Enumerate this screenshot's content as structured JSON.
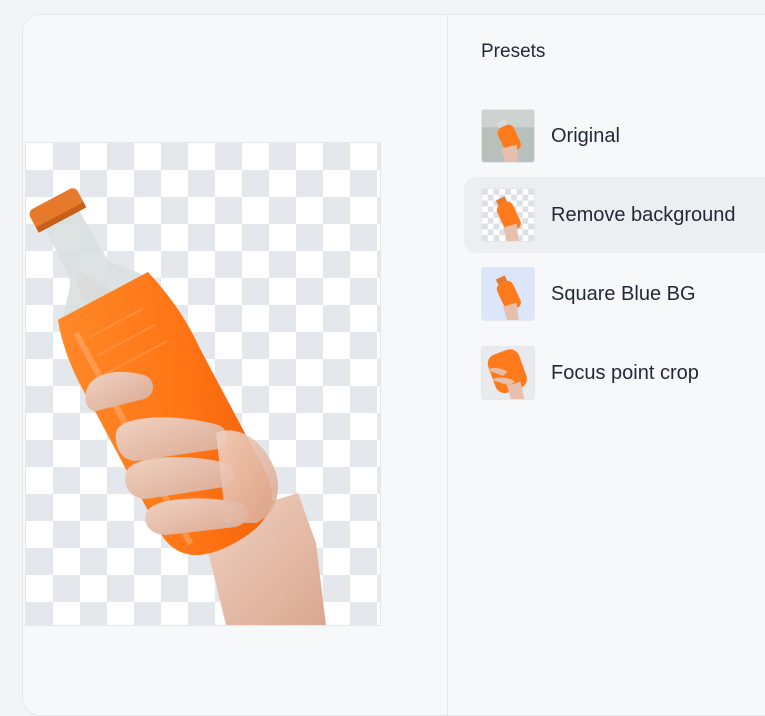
{
  "colors": {
    "page_bg": "#f3f4f6",
    "panel_bg": "#f7f8fa",
    "selected_bg": "#eceef2",
    "checker_dark": "#e4e7ec",
    "accent_orange": "#ff7a1a",
    "blue_bg": "#dbe6fb"
  },
  "preview": {
    "image_icon": "orange-soda-bottle-cutout"
  },
  "presets": {
    "title": "Presets",
    "items": [
      {
        "label": "Original",
        "thumb": "photo-original",
        "selected": false
      },
      {
        "label": "Remove background",
        "thumb": "transparent-cutout",
        "selected": true
      },
      {
        "label": "Square Blue BG",
        "thumb": "blue-square",
        "selected": false
      },
      {
        "label": "Focus point crop",
        "thumb": "crop-zoom",
        "selected": false
      }
    ]
  }
}
